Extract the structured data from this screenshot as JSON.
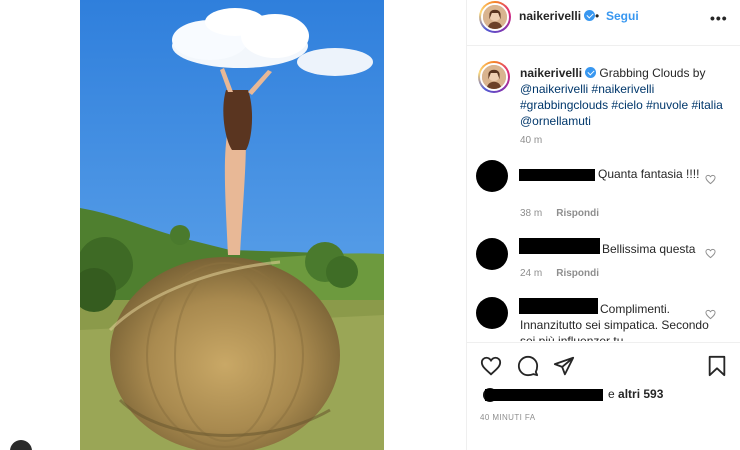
{
  "post": {
    "username": "naikerivelli",
    "follow_label": "Segui",
    "separator": "•"
  },
  "caption": {
    "username": "naikerivelli",
    "text_plain": "Grabbing Clouds by",
    "mention": "@naikerivelli",
    "hashtags": "#naikerivelli #grabbingclouds #cielo #nuvole #italia",
    "mention2": "@ornellamuti",
    "time": "40 m"
  },
  "comments": [
    {
      "text": "Quanta fantasia !!!!",
      "time": "38 m",
      "reply_label": "Rispondi"
    },
    {
      "text": "Bellissima questa",
      "time": "24 m",
      "reply_label": "Rispondi"
    },
    {
      "text": "Complimenti. Innanzitutto sei simpatica. Secondo sei più influenzer tu"
    }
  ],
  "likes": {
    "prefix": "e",
    "others": "altri 593"
  },
  "timestamp": "40 MINUTI FA",
  "icons": {
    "like": "heart-icon",
    "comment": "comment-icon",
    "share": "share-icon",
    "save": "bookmark-icon",
    "more": "more-icon",
    "verified": "verified-badge-icon"
  },
  "colors": {
    "link": "#3897f0",
    "tag": "#00376b",
    "muted": "#8e8e8e"
  }
}
